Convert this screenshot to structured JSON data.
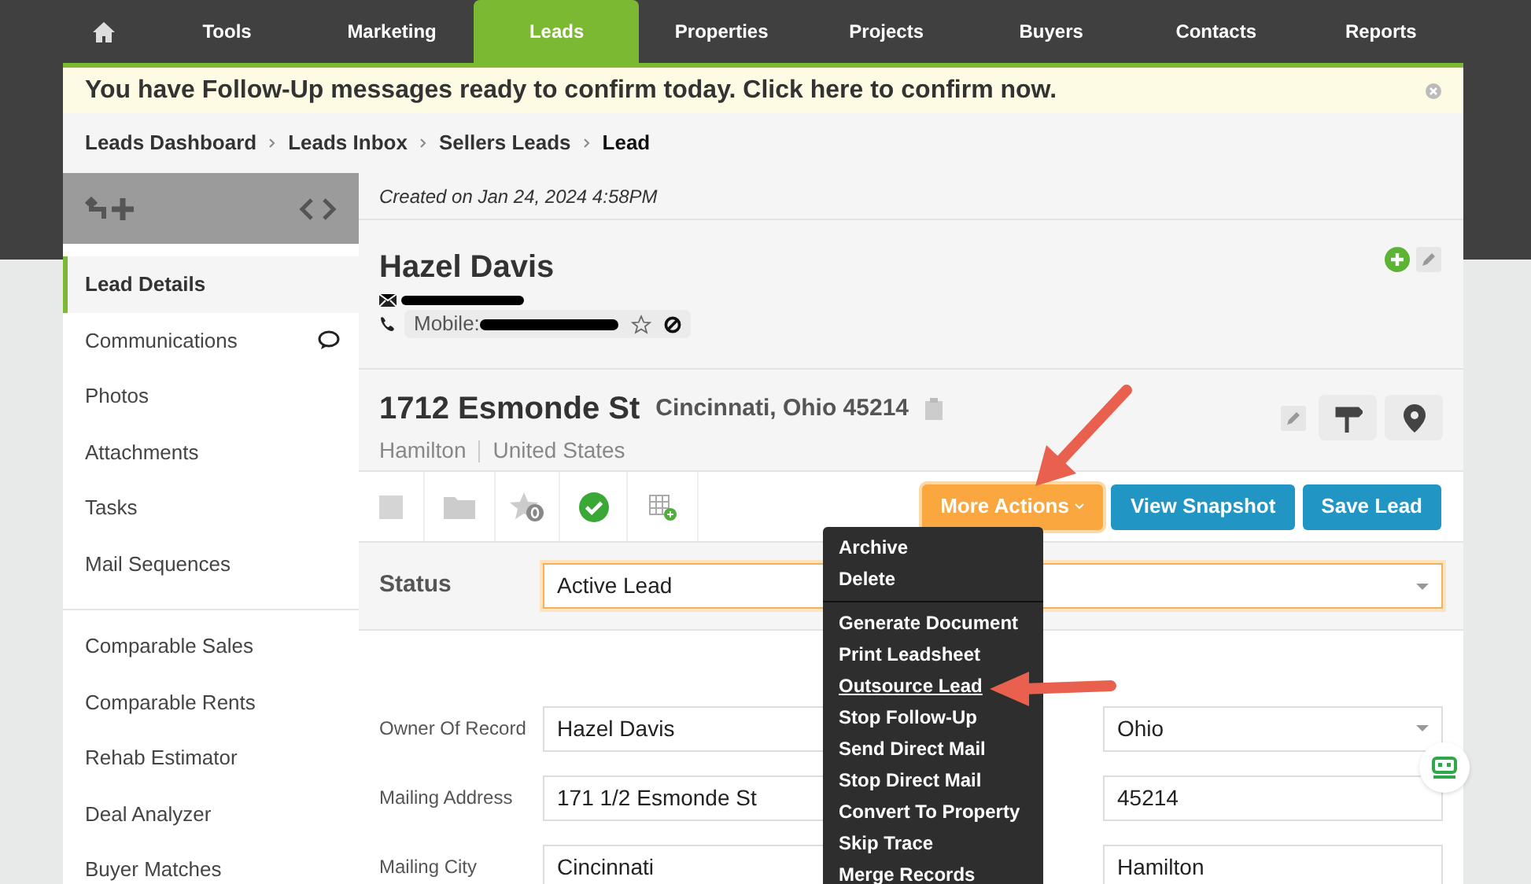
{
  "nav": {
    "tabs": [
      {
        "label": "Tools",
        "selected": false
      },
      {
        "label": "Marketing",
        "selected": false
      },
      {
        "label": "Leads",
        "selected": true
      },
      {
        "label": "Properties",
        "selected": false
      },
      {
        "label": "Projects",
        "selected": false
      },
      {
        "label": "Buyers",
        "selected": false
      },
      {
        "label": "Contacts",
        "selected": false
      },
      {
        "label": "Reports",
        "selected": false
      }
    ]
  },
  "banner": {
    "text": "You have Follow-Up messages ready to confirm today. Click here to confirm now."
  },
  "breadcrumbs": [
    {
      "label": "Leads Dashboard",
      "current": false
    },
    {
      "label": "Leads Inbox",
      "current": false
    },
    {
      "label": "Sellers Leads",
      "current": false
    },
    {
      "label": "Lead",
      "current": true
    }
  ],
  "sidebar": {
    "groups": [
      [
        {
          "label": "Lead Details",
          "selected": true,
          "kind": "plain"
        },
        {
          "label": "Communications",
          "selected": false,
          "kind": "chat"
        },
        {
          "label": "Photos",
          "selected": false,
          "kind": "plain"
        },
        {
          "label": "Attachments",
          "selected": false,
          "kind": "plain"
        },
        {
          "label": "Tasks",
          "selected": false,
          "kind": "plain"
        },
        {
          "label": "Mail Sequences",
          "selected": false,
          "kind": "plain"
        }
      ],
      [
        {
          "label": "Comparable Sales",
          "selected": false,
          "kind": "plain"
        },
        {
          "label": "Comparable Rents",
          "selected": false,
          "kind": "plain"
        },
        {
          "label": "Rehab Estimator",
          "selected": false,
          "kind": "plain"
        },
        {
          "label": "Deal Analyzer",
          "selected": false,
          "kind": "plain"
        },
        {
          "label": "Buyer Matches",
          "selected": false,
          "kind": "plain"
        }
      ]
    ]
  },
  "lead": {
    "created": "Created on Jan 24, 2024 4:58PM",
    "name": "Hazel Davis",
    "phone_label": "Mobile:",
    "street": "1712 Esmonde St",
    "city_line": "Cincinnati, Ohio 45214",
    "county": "Hamilton",
    "country": "United States"
  },
  "actions": [
    {
      "label": "More Actions",
      "kind": "dropdown"
    },
    {
      "label": "View Snapshot",
      "kind": "primary"
    },
    {
      "label": "Save Lead",
      "kind": "primary"
    }
  ],
  "status": {
    "label": "Status",
    "value": "Active Lead"
  },
  "form": {
    "left": [
      {
        "label": "Owner Of Record",
        "value": "Hazel Davis"
      },
      {
        "label": "Mailing Address",
        "value": "171 1/2 Esmonde St"
      },
      {
        "label": "Mailing City",
        "value": "Cincinnati"
      }
    ],
    "right": [
      {
        "value": "Ohio",
        "kind": "select"
      },
      {
        "value": "45214",
        "kind": "text"
      },
      {
        "value": "Hamilton",
        "kind": "text"
      }
    ]
  },
  "menu": {
    "groups": [
      [
        {
          "label": "Archive",
          "selected": false
        },
        {
          "label": "Delete",
          "selected": false
        }
      ],
      [
        {
          "label": "Generate Document",
          "selected": false
        },
        {
          "label": "Print Leadsheet",
          "selected": false
        },
        {
          "label": "Outsource Lead",
          "selected": true
        },
        {
          "label": "Stop Follow-Up",
          "selected": false
        },
        {
          "label": "Send Direct Mail",
          "selected": false
        },
        {
          "label": "Stop Direct Mail",
          "selected": false
        },
        {
          "label": "Convert To Property",
          "selected": false
        },
        {
          "label": "Skip Trace",
          "selected": false
        },
        {
          "label": "Merge Records",
          "selected": false
        }
      ]
    ]
  }
}
